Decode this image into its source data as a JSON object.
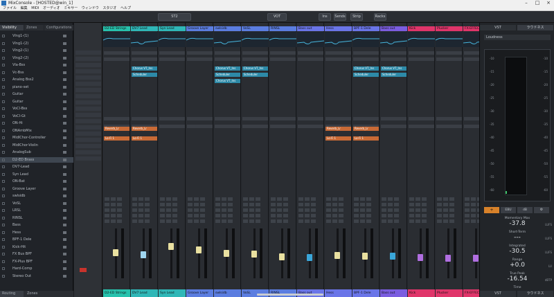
{
  "window": {
    "title": "MixConsole - [HOSTED@win_1]"
  },
  "menu": [
    "ファイル",
    "編集",
    "MIDI",
    "オーディオ",
    "ミキサー",
    "ウィンドウ",
    "スタジオ",
    "ヘルプ"
  ],
  "toolbar": {
    "field1": "ST2",
    "field2": "VOT",
    "btn_a": "Ins",
    "btn_b": "Sends",
    "btn_c": "Strip",
    "btn_d": "Racks"
  },
  "left_panel": {
    "tabs": [
      "Visibility",
      "Zones",
      "Configurations"
    ],
    "tracks": [
      "Vlng1-(1)",
      "Vlng1-(2)",
      "Vlng2-(1)",
      "Vlng2-(2)",
      "Vla-Bss",
      "Vc-Bss",
      "Analog Bss2",
      "piano-set",
      "Guitar",
      "Guitar",
      "VoCl-Bss",
      "VoCl-Gt",
      "ON-Hi",
      "ONAmbMix",
      "MidlChor-Controller",
      "MidlChor-Violin",
      "AnalogSub",
      "D2-ED Brass",
      "DV7-Lead",
      "Syn Lead",
      "ON-Bat",
      "Groove Layer",
      "swlsidb",
      "VoSL",
      "LRSL",
      "RINSL",
      "Bass",
      "Hess",
      "BPF-1 Dele",
      "Kick-Hit",
      "FX Bus BPF",
      "FX-Plus BPF",
      "Hard-Comp",
      "Stereo Out"
    ],
    "selected_index": 17,
    "bottom_tabs": [
      "Routing",
      "Zones"
    ]
  },
  "channels": [
    {
      "name": "D2-ED Strings",
      "color": "#27c2ad",
      "fader": 0.52,
      "fader_color": "#e9e0a0"
    },
    {
      "name": "DV7 Lead",
      "color": "#2fb7b7",
      "fader": 0.46,
      "fader_color": "#9fd6f0"
    },
    {
      "name": "Syn Lead",
      "color": "#2fb7b7",
      "fader": 0.66,
      "fader_color": "#e9e0a0"
    },
    {
      "name": "Groove Layer",
      "color": "#5b7de0",
      "fader": 0.58,
      "fader_color": "#e9e0a0"
    },
    {
      "name": "swlsidb",
      "color": "#5b7de0",
      "fader": 0.5,
      "fader_color": "#e9e0a0"
    },
    {
      "name": "VoSL",
      "color": "#5b7de0",
      "fader": 0.48,
      "fader_color": "#e9e0a0"
    },
    {
      "name": "RINSL",
      "color": "#5b7de0",
      "fader": 0.42,
      "fader_color": "#e9e0a0"
    },
    {
      "name": "Bass out",
      "color": "#6a75e8",
      "fader": 0.4,
      "fader_color": "#3aa6d9"
    },
    {
      "name": "Hess",
      "color": "#6a75e8",
      "fader": 0.45,
      "fader_color": "#e9e0a0"
    },
    {
      "name": "BPF-1 Dele",
      "color": "#6a75e8",
      "fader": 0.43,
      "fader_color": "#e9e0a0"
    },
    {
      "name": "Bass out",
      "color": "#7b5de0",
      "fader": 0.44,
      "fader_color": "#3aa6d9"
    },
    {
      "name": "Kick",
      "color": "#e0356a",
      "fader": 0.41,
      "fader_color": "#b06ee0"
    },
    {
      "name": "Plucker",
      "color": "#e0356a",
      "fader": 0.39,
      "fader_color": "#b06ee0"
    },
    {
      "name": "FX-EFFECT",
      "color": "#e0356a",
      "fader": 0.38,
      "fader_color": "#b06ee0"
    }
  ],
  "insert_labels": {
    "blue1": "Chorus VT_Ins",
    "blue2": "Scheduler",
    "orange1": "Reverb_Lr",
    "orange2": "Lo-Fi 1"
  },
  "right_panel": {
    "tabs": [
      "VST",
      "ラウドネス"
    ],
    "header": "Loudness",
    "meter_ticks_left": [
      "-10",
      "-15",
      "-20",
      "-25",
      "-30",
      "-35",
      "-40",
      "-45",
      "-50",
      "-55",
      "-60"
    ],
    "meter_ticks_right": [
      "-10",
      "-15",
      "-20",
      "-25",
      "-30",
      "-35",
      "-40",
      "-45",
      "-50",
      "-55",
      "-60"
    ],
    "controls": [
      "EBU",
      "dB"
    ],
    "stats": [
      {
        "label": "Momentary Max",
        "value": "-37.8"
      },
      {
        "label": "Short-Term",
        "value": "---"
      },
      {
        "label": "Integrated",
        "value": "-30.5"
      },
      {
        "label": "Range",
        "value": "+0.0"
      },
      {
        "label": "True Peak",
        "value": "-16.54"
      },
      {
        "label": "Time",
        "value": ""
      }
    ],
    "units": [
      "LUFS",
      "LUFS",
      "LUFS",
      "LU",
      "dBTP"
    ],
    "bottom_tabs": [
      "VST",
      "ラウドネス"
    ]
  }
}
